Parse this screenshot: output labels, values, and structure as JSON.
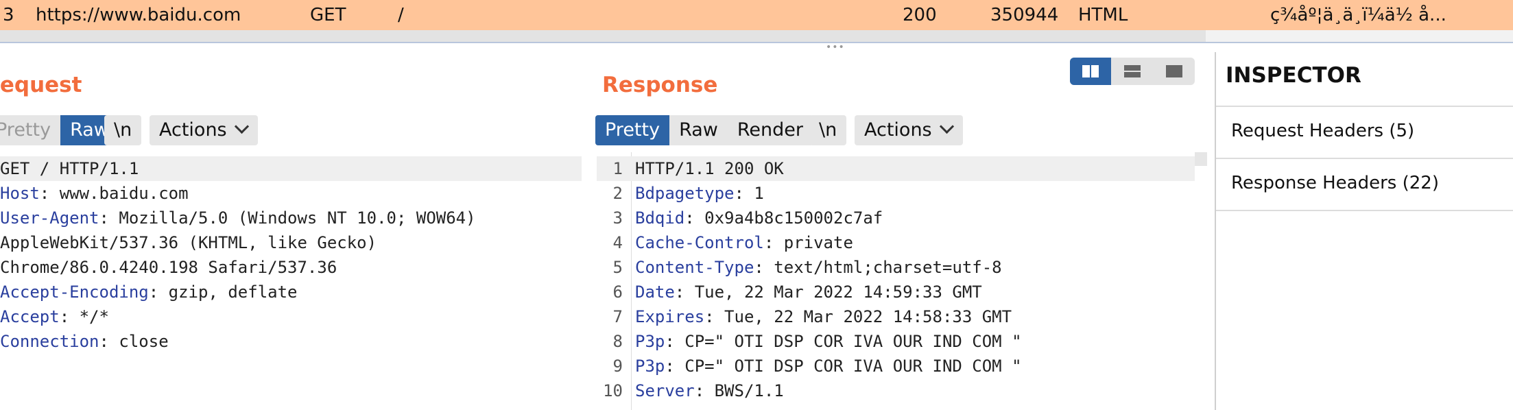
{
  "history_row": {
    "id": "3",
    "host": "https://www.baidu.com",
    "method": "GET",
    "url": "/",
    "status": "200",
    "length": "350944",
    "mime": "HTML",
    "title": "ç¾åº¦ä¸ä¸ï¼ä½ å..."
  },
  "split_handle": "•••",
  "request": {
    "title": "Request",
    "tabs": {
      "pretty": "Pretty",
      "raw": "Raw",
      "newline": "\\n",
      "actions": "Actions"
    },
    "lines": [
      {
        "name": "",
        "value": "GET / HTTP/1.1"
      },
      {
        "name": "Host",
        "value": ": www.baidu.com"
      },
      {
        "name": "User-Agent",
        "value": ": Mozilla/5.0 (Windows NT 10.0; WOW64)"
      },
      {
        "name": "",
        "value": "AppleWebKit/537.36 (KHTML, like Gecko)"
      },
      {
        "name": "",
        "value": "Chrome/86.0.4240.198 Safari/537.36"
      },
      {
        "name": "Accept-Encoding",
        "value": ": gzip, deflate"
      },
      {
        "name": "Accept",
        "value": ": */*"
      },
      {
        "name": "Connection",
        "value": ": close"
      }
    ]
  },
  "response": {
    "title": "Response",
    "tabs": {
      "pretty": "Pretty",
      "raw": "Raw",
      "render": "Render",
      "newline": "\\n",
      "actions": "Actions"
    },
    "lines": [
      {
        "num": "1",
        "name": "",
        "value": "HTTP/1.1 200 OK"
      },
      {
        "num": "2",
        "name": "Bdpagetype",
        "value": ": 1"
      },
      {
        "num": "3",
        "name": "Bdqid",
        "value": ": 0x9a4b8c150002c7af"
      },
      {
        "num": "4",
        "name": "Cache-Control",
        "value": ": private"
      },
      {
        "num": "5",
        "name": "Content-Type",
        "value": ": text/html;charset=utf-8"
      },
      {
        "num": "6",
        "name": "Date",
        "value": ": Tue, 22 Mar 2022 14:59:33 GMT"
      },
      {
        "num": "7",
        "name": "Expires",
        "value": ": Tue, 22 Mar 2022 14:58:33 GMT"
      },
      {
        "num": "8",
        "name": "P3p",
        "value": ": CP=\" OTI DSP COR IVA OUR IND COM \""
      },
      {
        "num": "9",
        "name": "P3p",
        "value": ": CP=\" OTI DSP COR IVA OUR IND COM \""
      },
      {
        "num": "10",
        "name": "Server",
        "value": ": BWS/1.1"
      }
    ]
  },
  "inspector": {
    "title": "INSPECTOR",
    "sections": [
      {
        "label": "Request Headers (5)"
      },
      {
        "label": "Response Headers (22)"
      }
    ]
  },
  "colors": {
    "accent": "#2d64a6",
    "title_orange": "#f26d3d",
    "row_highlight": "#ffc599",
    "header_name": "#2a3f9e"
  }
}
